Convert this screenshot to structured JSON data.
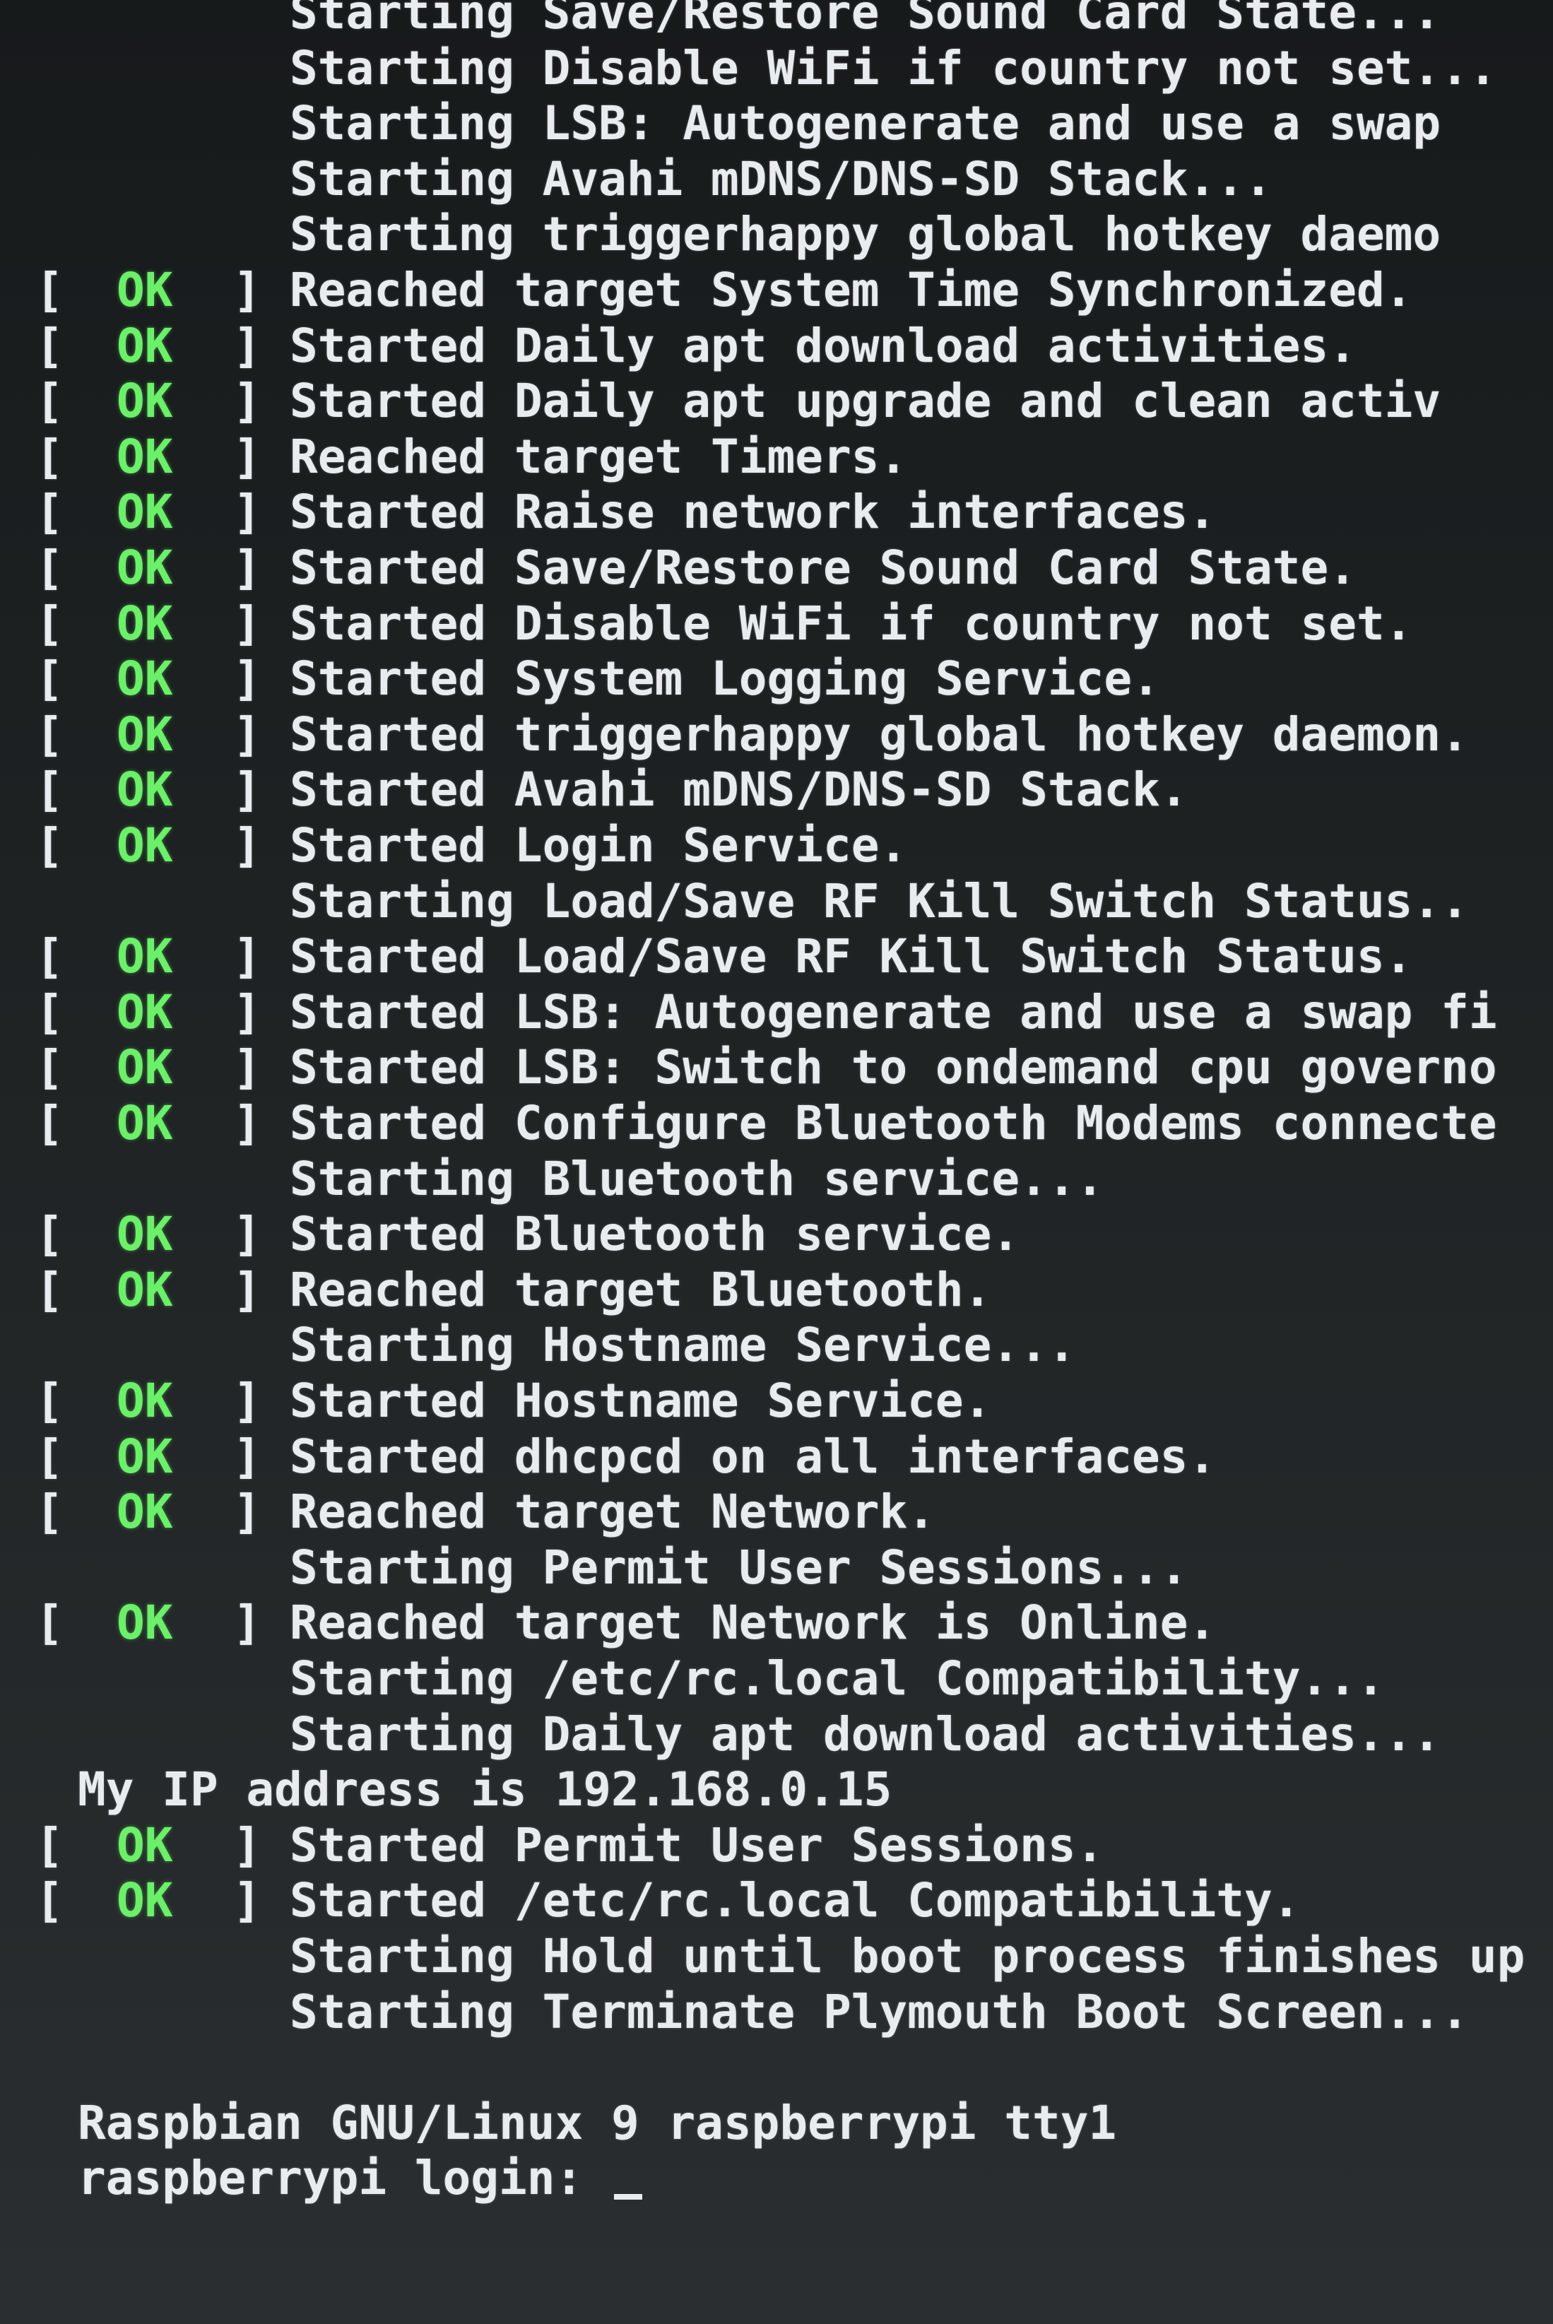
{
  "status_label": "OK",
  "lines": [
    {
      "kind": "plain",
      "text": "Starting Save/Restore Sound Card State..."
    },
    {
      "kind": "plain",
      "text": "Starting Disable WiFi if country not set..."
    },
    {
      "kind": "plain",
      "text": "Starting LSB: Autogenerate and use a swap"
    },
    {
      "kind": "plain",
      "text": "Starting Avahi mDNS/DNS-SD Stack..."
    },
    {
      "kind": "plain",
      "text": "Starting triggerhappy global hotkey daemo"
    },
    {
      "kind": "ok",
      "text": "Reached target System Time Synchronized."
    },
    {
      "kind": "ok",
      "text": "Started Daily apt download activities."
    },
    {
      "kind": "ok",
      "text": "Started Daily apt upgrade and clean activ"
    },
    {
      "kind": "ok",
      "text": "Reached target Timers."
    },
    {
      "kind": "ok",
      "text": "Started Raise network interfaces."
    },
    {
      "kind": "ok",
      "text": "Started Save/Restore Sound Card State."
    },
    {
      "kind": "ok",
      "text": "Started Disable WiFi if country not set."
    },
    {
      "kind": "ok",
      "text": "Started System Logging Service."
    },
    {
      "kind": "ok",
      "text": "Started triggerhappy global hotkey daemon."
    },
    {
      "kind": "ok",
      "text": "Started Avahi mDNS/DNS-SD Stack."
    },
    {
      "kind": "ok",
      "text": "Started Login Service."
    },
    {
      "kind": "plain",
      "text": "Starting Load/Save RF Kill Switch Status.."
    },
    {
      "kind": "ok",
      "text": "Started Load/Save RF Kill Switch Status."
    },
    {
      "kind": "ok",
      "text": "Started LSB: Autogenerate and use a swap fi"
    },
    {
      "kind": "ok",
      "text": "Started LSB: Switch to ondemand cpu governo"
    },
    {
      "kind": "ok",
      "text": "Started Configure Bluetooth Modems connecte"
    },
    {
      "kind": "plain",
      "text": "Starting Bluetooth service..."
    },
    {
      "kind": "ok",
      "text": "Started Bluetooth service."
    },
    {
      "kind": "ok",
      "text": "Reached target Bluetooth."
    },
    {
      "kind": "plain",
      "text": "Starting Hostname Service..."
    },
    {
      "kind": "ok",
      "text": "Started Hostname Service."
    },
    {
      "kind": "ok",
      "text": "Started dhcpcd on all interfaces."
    },
    {
      "kind": "ok",
      "text": "Reached target Network."
    },
    {
      "kind": "plain",
      "text": "Starting Permit User Sessions..."
    },
    {
      "kind": "ok",
      "text": "Reached target Network is Online."
    },
    {
      "kind": "plain",
      "text": "Starting /etc/rc.local Compatibility..."
    },
    {
      "kind": "plain",
      "text": "Starting Daily apt download activities..."
    },
    {
      "kind": "info",
      "text": "My IP address is 192.168.0.15"
    },
    {
      "kind": "ok",
      "text": "Started Permit User Sessions."
    },
    {
      "kind": "ok",
      "text": "Started /etc/rc.local Compatibility."
    },
    {
      "kind": "plain",
      "text": "Starting Hold until boot process finishes up"
    },
    {
      "kind": "plain",
      "text": "Starting Terminate Plymouth Boot Screen..."
    },
    {
      "kind": "blank",
      "text": ""
    },
    {
      "kind": "info",
      "text": "Raspbian GNU/Linux 9 raspberrypi tty1"
    },
    {
      "kind": "prompt",
      "text": "raspberrypi login: "
    }
  ]
}
